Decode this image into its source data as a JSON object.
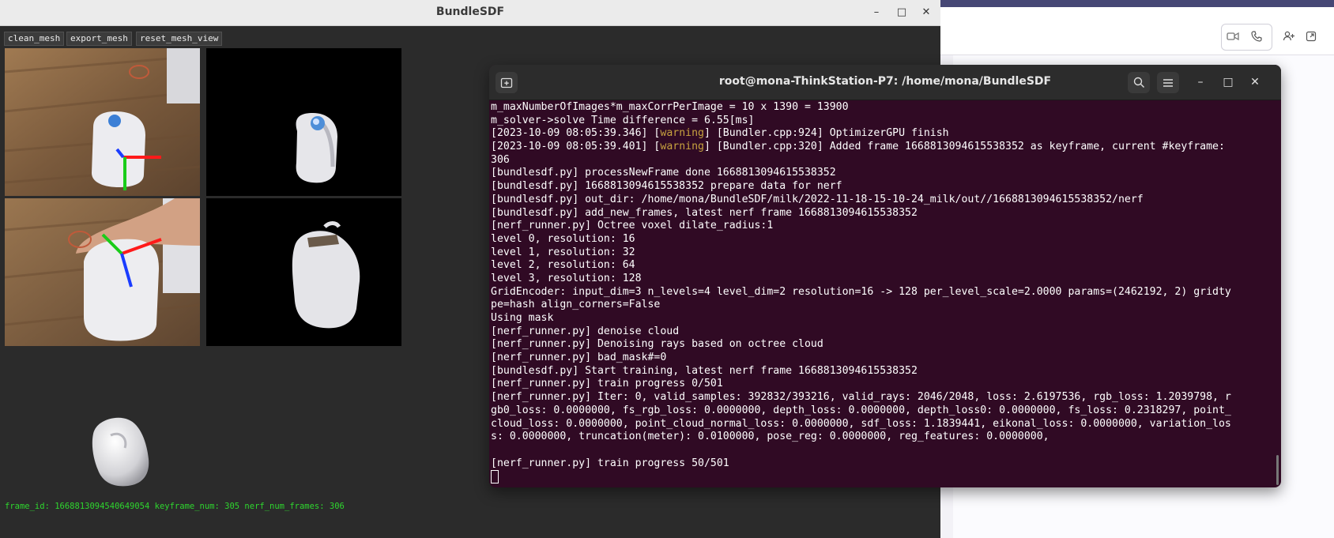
{
  "background_app": {
    "header_icons": [
      "video-icon",
      "phone-icon",
      "people-add-icon",
      "popout-icon"
    ]
  },
  "viewer": {
    "title": "BundleSDF",
    "buttons": [
      "clean_mesh",
      "export_mesh",
      "reset_mesh_view"
    ],
    "status_text": "frame_id: 1668813094540649054 keyframe_num: 305 nerf_num_frames: 306",
    "axis_colors": {
      "x": "#ff1a1a",
      "y": "#1acc1a",
      "z": "#1a3cff"
    }
  },
  "terminal": {
    "title": "root@mona-ThinkStation-P7: /home/mona/BundleSDF",
    "lines": [
      {
        "text": "m_maxNumberOfImages*m_maxCorrPerImage = 10 x 1390 = 13900"
      },
      {
        "text": "m_solver->solve Time difference = 6.55[ms]"
      },
      {
        "pre": "[2023-10-09 08:05:39.346] [",
        "warn": "warning",
        "post": "] [Bundler.cpp:924] OptimizerGPU finish"
      },
      {
        "pre": "[2023-10-09 08:05:39.401] [",
        "warn": "warning",
        "post": "] [Bundler.cpp:320] Added frame 1668813094615538352 as keyframe, current #keyframe:"
      },
      {
        "text": "306"
      },
      {
        "text": "[bundlesdf.py] processNewFrame done 1668813094615538352"
      },
      {
        "text": "[bundlesdf.py] 1668813094615538352 prepare data for nerf"
      },
      {
        "text": "[bundlesdf.py] out_dir: /home/mona/BundleSDF/milk/2022-11-18-15-10-24_milk/out//1668813094615538352/nerf"
      },
      {
        "text": "[bundlesdf.py] add_new_frames, latest nerf frame 1668813094615538352"
      },
      {
        "text": "[nerf_runner.py] Octree voxel dilate_radius:1"
      },
      {
        "text": "level 0, resolution: 16"
      },
      {
        "text": "level 1, resolution: 32"
      },
      {
        "text": "level 2, resolution: 64"
      },
      {
        "text": "level 3, resolution: 128"
      },
      {
        "text": "GridEncoder: input_dim=3 n_levels=4 level_dim=2 resolution=16 -> 128 per_level_scale=2.0000 params=(2462192, 2) gridty"
      },
      {
        "text": "pe=hash align_corners=False"
      },
      {
        "text": "Using mask"
      },
      {
        "text": "[nerf_runner.py] denoise cloud"
      },
      {
        "text": "[nerf_runner.py] Denoising rays based on octree cloud"
      },
      {
        "text": "[nerf_runner.py] bad_mask#=0"
      },
      {
        "text": "[bundlesdf.py] Start training, latest nerf frame 1668813094615538352"
      },
      {
        "text": "[nerf_runner.py] train progress 0/501"
      },
      {
        "text": "[nerf_runner.py] Iter: 0, valid_samples: 392832/393216, valid_rays: 2046/2048, loss: 2.6197536, rgb_loss: 1.2039798, r"
      },
      {
        "text": "gb0_loss: 0.0000000, fs_rgb_loss: 0.0000000, depth_loss: 0.0000000, depth_loss0: 0.0000000, fs_loss: 0.2318297, point_"
      },
      {
        "text": "cloud_loss: 0.0000000, point_cloud_normal_loss: 0.0000000, sdf_loss: 1.1839441, eikonal_loss: 0.0000000, variation_los"
      },
      {
        "text": "s: 0.0000000, truncation(meter): 0.0100000, pose_reg: 0.0000000, reg_features: 0.0000000,"
      },
      {
        "text": ""
      },
      {
        "text": "[nerf_runner.py] train progress 50/501"
      }
    ],
    "titlebar_icons": [
      "new-tab-icon",
      "search-icon",
      "menu-icon"
    ]
  }
}
